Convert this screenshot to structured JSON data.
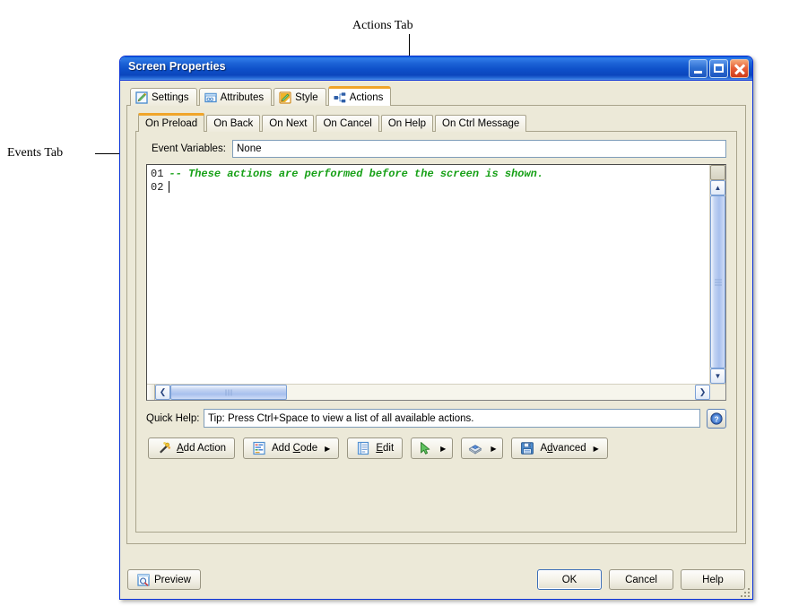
{
  "annotations": [
    {
      "label": "Actions Tab"
    },
    {
      "label": "Events Tab"
    }
  ],
  "window": {
    "title": "Screen Properties",
    "titlebar_buttons": [
      {
        "name": "minimize",
        "glyph": "_"
      },
      {
        "name": "maximize",
        "glyph": "❐"
      },
      {
        "name": "close",
        "glyph": "✕"
      }
    ]
  },
  "outer_tabs": [
    {
      "label": "Settings",
      "icon": "pencil-note-icon",
      "active": false
    },
    {
      "label": "Attributes",
      "icon": "attributes-window-icon",
      "active": false
    },
    {
      "label": "Style",
      "icon": "style-palette-icon",
      "active": false
    },
    {
      "label": "Actions",
      "icon": "actions-node-tree-icon",
      "active": true
    }
  ],
  "inner_tabs": [
    {
      "label": "On Preload",
      "active": true
    },
    {
      "label": "On Back",
      "active": false
    },
    {
      "label": "On Next",
      "active": false
    },
    {
      "label": "On Cancel",
      "active": false
    },
    {
      "label": "On Help",
      "active": false
    },
    {
      "label": "On Ctrl Message",
      "active": false
    }
  ],
  "event_variables": {
    "label": "Event Variables:",
    "value": "None"
  },
  "editor": {
    "lines": [
      {
        "number": "01",
        "text": "-- These actions are performed before the screen is shown.",
        "kind": "comment"
      },
      {
        "number": "02",
        "text": "",
        "kind": "empty"
      }
    ],
    "vertical_scrollbar": {
      "up_glyph": "▲",
      "down_glyph": "▼"
    },
    "horizontal_scrollbar": {
      "left_glyph": "❮",
      "right_glyph": "❯"
    }
  },
  "quick_help": {
    "label": "Quick Help:",
    "value": "Tip: Press Ctrl+Space to view a list of all available actions.",
    "help_button_icon": "question-mark-icon"
  },
  "action_buttons": [
    {
      "label_pre": "",
      "accel": "A",
      "label_post": "dd Action",
      "icon": "magic-wand-icon",
      "has_arrow": false,
      "name": "add-action-button"
    },
    {
      "label_pre": "Add ",
      "accel": "C",
      "label_post": "ode",
      "icon": "code-list-icon",
      "has_arrow": true,
      "name": "add-code-button"
    },
    {
      "label_pre": "",
      "accel": "E",
      "label_post": "dit",
      "icon": "edit-document-icon",
      "has_arrow": false,
      "name": "edit-button"
    },
    {
      "label_pre": "",
      "accel": "",
      "label_post": "",
      "icon": "green-cursor-run-icon",
      "has_arrow": true,
      "name": "run-button"
    },
    {
      "label_pre": "",
      "accel": "",
      "label_post": "",
      "icon": "package-plugin-icon",
      "has_arrow": true,
      "name": "plugin-button"
    },
    {
      "label_pre": "A",
      "accel": "d",
      "label_post": "vanced",
      "icon": "floppy-save-icon",
      "has_arrow": true,
      "name": "advanced-button"
    }
  ],
  "bottom_buttons": {
    "preview": {
      "label": "Preview",
      "icon": "preview-magnifier-icon"
    },
    "ok": {
      "label": "OK",
      "is_default": true
    },
    "cancel": {
      "label": "Cancel"
    },
    "help": {
      "label": "Help"
    }
  },
  "colors": {
    "dialog_face": "#ece9d8",
    "titlebar_blue": "#0b46bd",
    "active_tab_accent": "#f0a52a",
    "comment_green": "#16a016",
    "scrollbar_blue": "#a8c0ee",
    "window_border": "#0831d9"
  }
}
